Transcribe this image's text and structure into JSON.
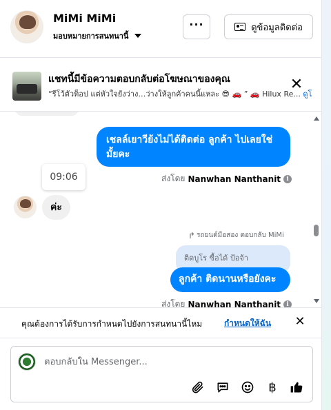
{
  "header": {
    "contact_name": "MiMi MiMi",
    "assign_label": "มอบหมายการสนทนานี้",
    "more_label": "···",
    "contact_info_label": "ดูข้อมูลติดต่อ"
  },
  "ad_banner": {
    "title": "แชทนี้มีข้อความตอบกลับต่อโฆษณาของคุณ",
    "snippet_text": "“รีโว้ตัวท็อป แต่หัวใจยังว่าง…ว่างให้ลูกค้าคนนี้แหละ 😎 🚗 ” 🚗 Hilux Re...",
    "snippet_link": "ดูโ"
  },
  "messages": {
    "bubble_1": "เชลล์เยาวีย้งไม่ได้ติดต่อ ลูกค้า  ไปเลยใช่มั้ยคะ",
    "sent_by_prefix": "ส่งโดย",
    "sent_by_name": "Nanwhan Nanthanit",
    "time": "09:06",
    "incoming": "ค่ะ",
    "reply_header": "รถยนต์มือสอง ตอบกลับ MiMi",
    "quoted": "ติดบูโร ซื้อได้ ป้อจ้า",
    "bubble_2": "ลูกค้า ติดนานหรือยังคะ"
  },
  "notice": {
    "text": "คุณต้องการได้รับการกำหนดไปยังการสนทนานี้ไหม",
    "link": "กำหนดให้ฉัน"
  },
  "composer": {
    "placeholder": "ตอบกลับใน Messenger..."
  },
  "colors": {
    "accent": "#0084ff",
    "link": "#0064d1",
    "quoted_bg": "#dce9fb"
  }
}
